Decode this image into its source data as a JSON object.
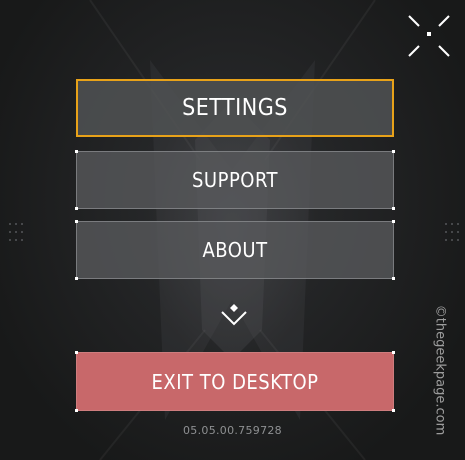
{
  "menu": {
    "settings_label": "SETTINGS",
    "support_label": "SUPPORT",
    "about_label": "ABOUT",
    "exit_label": "EXIT TO DESKTOP"
  },
  "footer": {
    "version": "05.05.00.759728"
  },
  "watermark": {
    "text": "©thegeekpage.com"
  },
  "icons": {
    "fullscreen": "fullscreen-toggle-icon",
    "expand": "chevron-down-icon"
  },
  "colors": {
    "selected_border": "#e8a219",
    "button_fill": "#585a5c",
    "exit_fill": "#c8686a",
    "text": "#ffffff",
    "version_text": "#8e9092"
  }
}
